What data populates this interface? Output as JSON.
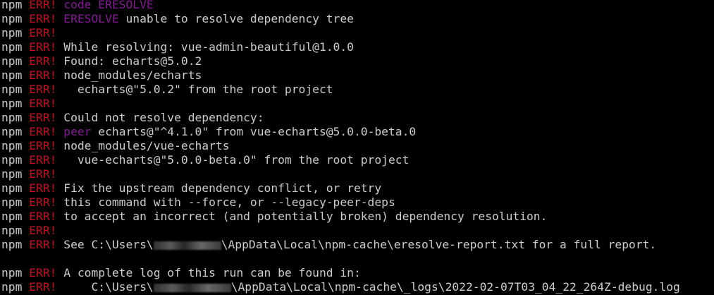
{
  "terminal": {
    "colors": {
      "background": "#000000",
      "text": "#cccccc",
      "err": "#c50f1f",
      "magenta": "#881798"
    },
    "prefix": "npm",
    "err_label": "ERR!",
    "lines": [
      {
        "kind": "err",
        "parts": [
          {
            "text": "code ERESOLVE",
            "color": "magenta"
          }
        ]
      },
      {
        "kind": "err",
        "parts": [
          {
            "text": "ERESOLVE",
            "color": "magenta"
          },
          {
            "text": " unable to resolve dependency tree",
            "color": "text"
          }
        ]
      },
      {
        "kind": "err",
        "parts": []
      },
      {
        "kind": "err",
        "parts": [
          {
            "text": "While resolving: vue-admin-beautiful@1.0.0",
            "color": "text"
          }
        ]
      },
      {
        "kind": "err",
        "parts": [
          {
            "text": "Found: echarts@5.0.2",
            "color": "text"
          }
        ]
      },
      {
        "kind": "err",
        "parts": [
          {
            "text": "node_modules/echarts",
            "color": "text"
          }
        ]
      },
      {
        "kind": "err",
        "parts": [
          {
            "text": "  echarts@\"5.0.2\" from the root project",
            "color": "text"
          }
        ]
      },
      {
        "kind": "err",
        "parts": []
      },
      {
        "kind": "err",
        "parts": [
          {
            "text": "Could not resolve dependency:",
            "color": "text"
          }
        ]
      },
      {
        "kind": "err",
        "parts": [
          {
            "text": "peer",
            "color": "magenta"
          },
          {
            "text": " echarts@\"^4.1.0\" from vue-echarts@5.0.0-beta.0",
            "color": "text"
          }
        ]
      },
      {
        "kind": "err",
        "parts": [
          {
            "text": "node_modules/vue-echarts",
            "color": "text"
          }
        ]
      },
      {
        "kind": "err",
        "parts": [
          {
            "text": "  vue-echarts@\"5.0.0-beta.0\" from the root project",
            "color": "text"
          }
        ]
      },
      {
        "kind": "err",
        "parts": []
      },
      {
        "kind": "err",
        "parts": [
          {
            "text": "Fix the upstream dependency conflict, or retry",
            "color": "text"
          }
        ]
      },
      {
        "kind": "err",
        "parts": [
          {
            "text": "this command with --force, or --legacy-peer-deps",
            "color": "text"
          }
        ]
      },
      {
        "kind": "err",
        "parts": [
          {
            "text": "to accept an incorrect (and potentially broken) dependency resolution.",
            "color": "text"
          }
        ]
      },
      {
        "kind": "err",
        "parts": []
      },
      {
        "kind": "err",
        "parts": [
          {
            "text": "See C:\\Users\\",
            "color": "text"
          },
          {
            "redacted": true
          },
          {
            "text": "\\AppData\\Local\\npm-cache\\eresolve-report.txt for a full report.",
            "color": "text"
          }
        ]
      },
      {
        "kind": "blank",
        "parts": []
      },
      {
        "kind": "err",
        "parts": [
          {
            "text": "A complete log of this run can be found in:",
            "color": "text"
          }
        ]
      },
      {
        "kind": "err",
        "parts": [
          {
            "text": "    C:\\Users\\",
            "color": "text"
          },
          {
            "redacted": true
          },
          {
            "text": "\\AppData\\Local\\npm-cache\\_logs\\2022-02-07T03_04_22_264Z-debug.log",
            "color": "text"
          }
        ]
      }
    ]
  }
}
